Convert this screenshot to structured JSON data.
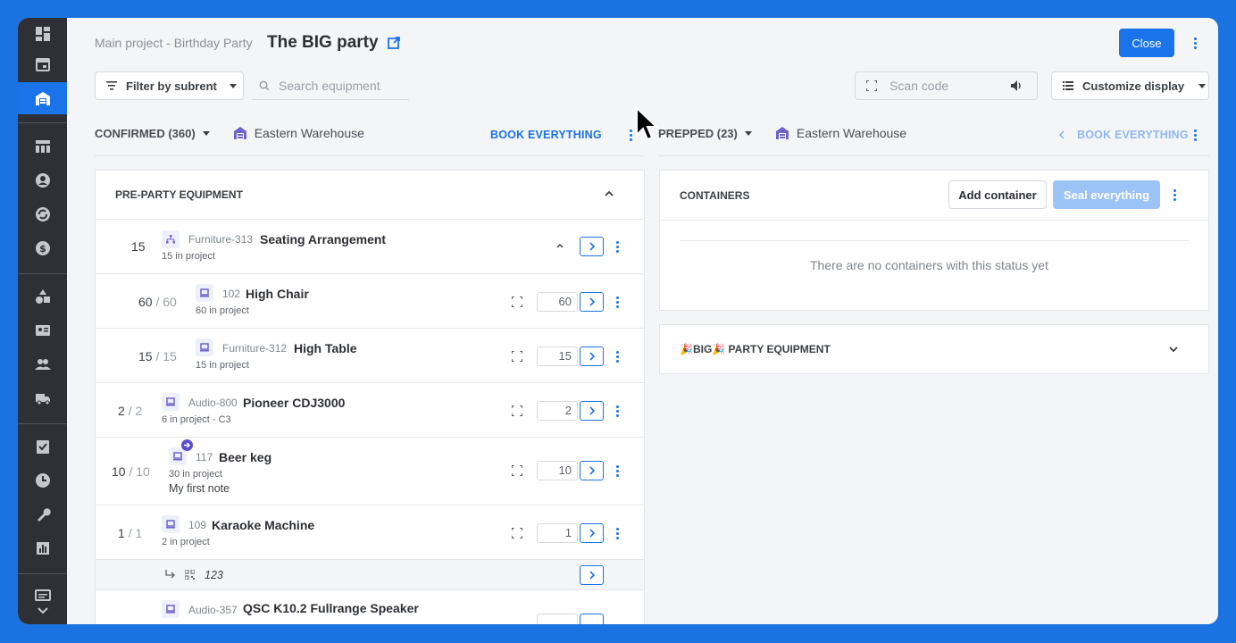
{
  "header": {
    "breadcrumb": "Main project - Birthday Party",
    "title": "The BIG party",
    "close_label": "Close"
  },
  "toolbar": {
    "filter_label": "Filter by subrent",
    "search_placeholder": "Search equipment",
    "scan_placeholder": "Scan code",
    "customize_label": "Customize display"
  },
  "left": {
    "status": "CONFIRMED (360)",
    "warehouse": "Eastern Warehouse",
    "book_label": "BOOK EVERYTHING",
    "group_title": "PRE-PARTY EQUIPMENT",
    "items": [
      {
        "qty": "15",
        "total": "",
        "code": "Furniture-313",
        "name": "Seating Arrangement",
        "meta": "15 in project",
        "input": ""
      },
      {
        "qty": "60",
        "total": "60",
        "code": "102",
        "name": "High Chair",
        "meta": "60 in project",
        "input": "60"
      },
      {
        "qty": "15",
        "total": "15",
        "code": "Furniture-312",
        "name": "High Table",
        "meta": "15 in project",
        "input": "15"
      },
      {
        "qty": "2",
        "total": "2",
        "code": "Audio-800",
        "name": "Pioneer CDJ3000",
        "meta": "6 in project - C3",
        "input": "2"
      },
      {
        "qty": "10",
        "total": "10",
        "code": "117",
        "name": "Beer keg",
        "meta": "30 in project",
        "note": "My first note",
        "input": "10"
      },
      {
        "qty": "1",
        "total": "1",
        "code": "109",
        "name": "Karaoke Machine",
        "meta": "2 in project",
        "input": "1"
      },
      {
        "sub_code": "123"
      },
      {
        "code": "Audio-357",
        "name": "QSC K10.2 Fullrange Speaker"
      }
    ]
  },
  "right": {
    "status": "PREPPED (23)",
    "warehouse": "Eastern Warehouse",
    "book_label": "BOOK EVERYTHING",
    "containers_title": "CONTAINERS",
    "add_container_label": "Add container",
    "seal_label": "Seal everything",
    "empty_text": "There are no containers with this status yet",
    "group_title": "🎉BIG🎉 PARTY EQUIPMENT"
  },
  "colors": {
    "accent": "#1a73e8",
    "sidebar": "#2e3036",
    "background": "#f4f5f7",
    "page_background": "#1a73e0"
  }
}
